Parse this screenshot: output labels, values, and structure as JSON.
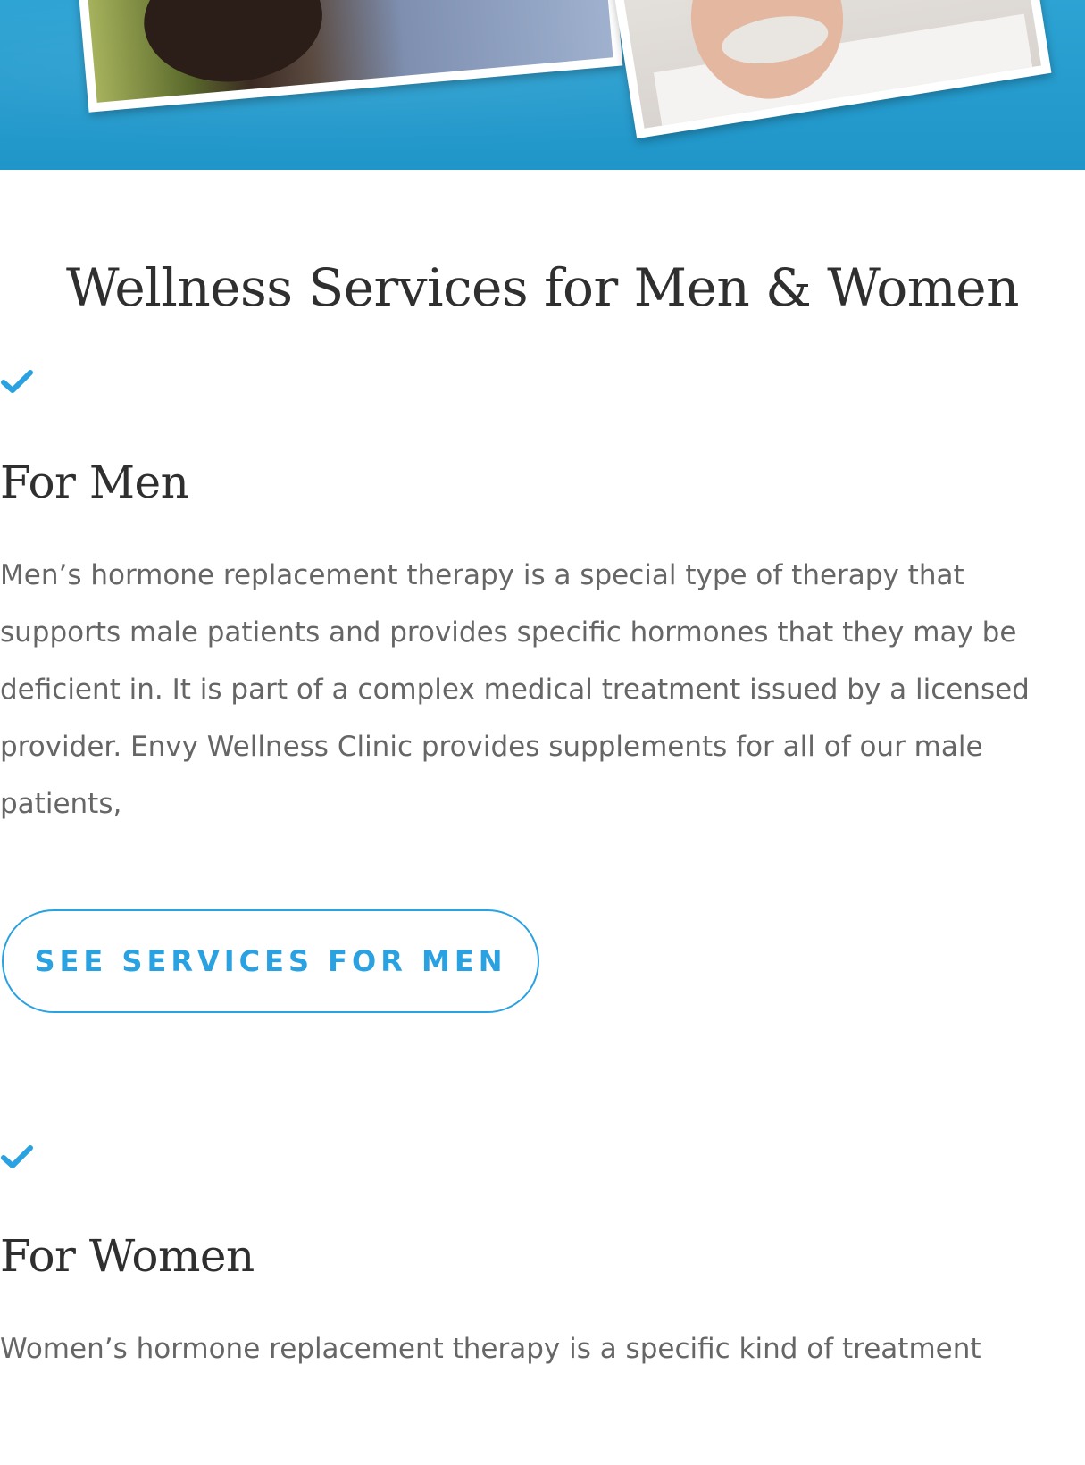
{
  "page": {
    "heading": "Wellness Services for Men & Women"
  },
  "colors": {
    "accent": "#2aa1e0",
    "hero_blue": "#1f95c8",
    "heading_text": "#2f2f2f",
    "body_text": "#666666"
  },
  "men_section": {
    "icon": "check-icon",
    "title": "For Men",
    "body_lines": [
      "Men’s hormone replacement therapy is a special type of therapy that",
      "supports male patients and provides specific hormones that they may be",
      "deficient in. It is part of a complex medical treatment issued by a licensed",
      "provider. Envy Wellness Clinic provides supplements for all of our male",
      "patients,"
    ],
    "button_label": "SEE SERVICES FOR MEN"
  },
  "women_section": {
    "icon": "check-icon",
    "title": "For Women",
    "body_lines": [
      "Women’s hormone replacement therapy is a specific kind of treatment"
    ]
  }
}
